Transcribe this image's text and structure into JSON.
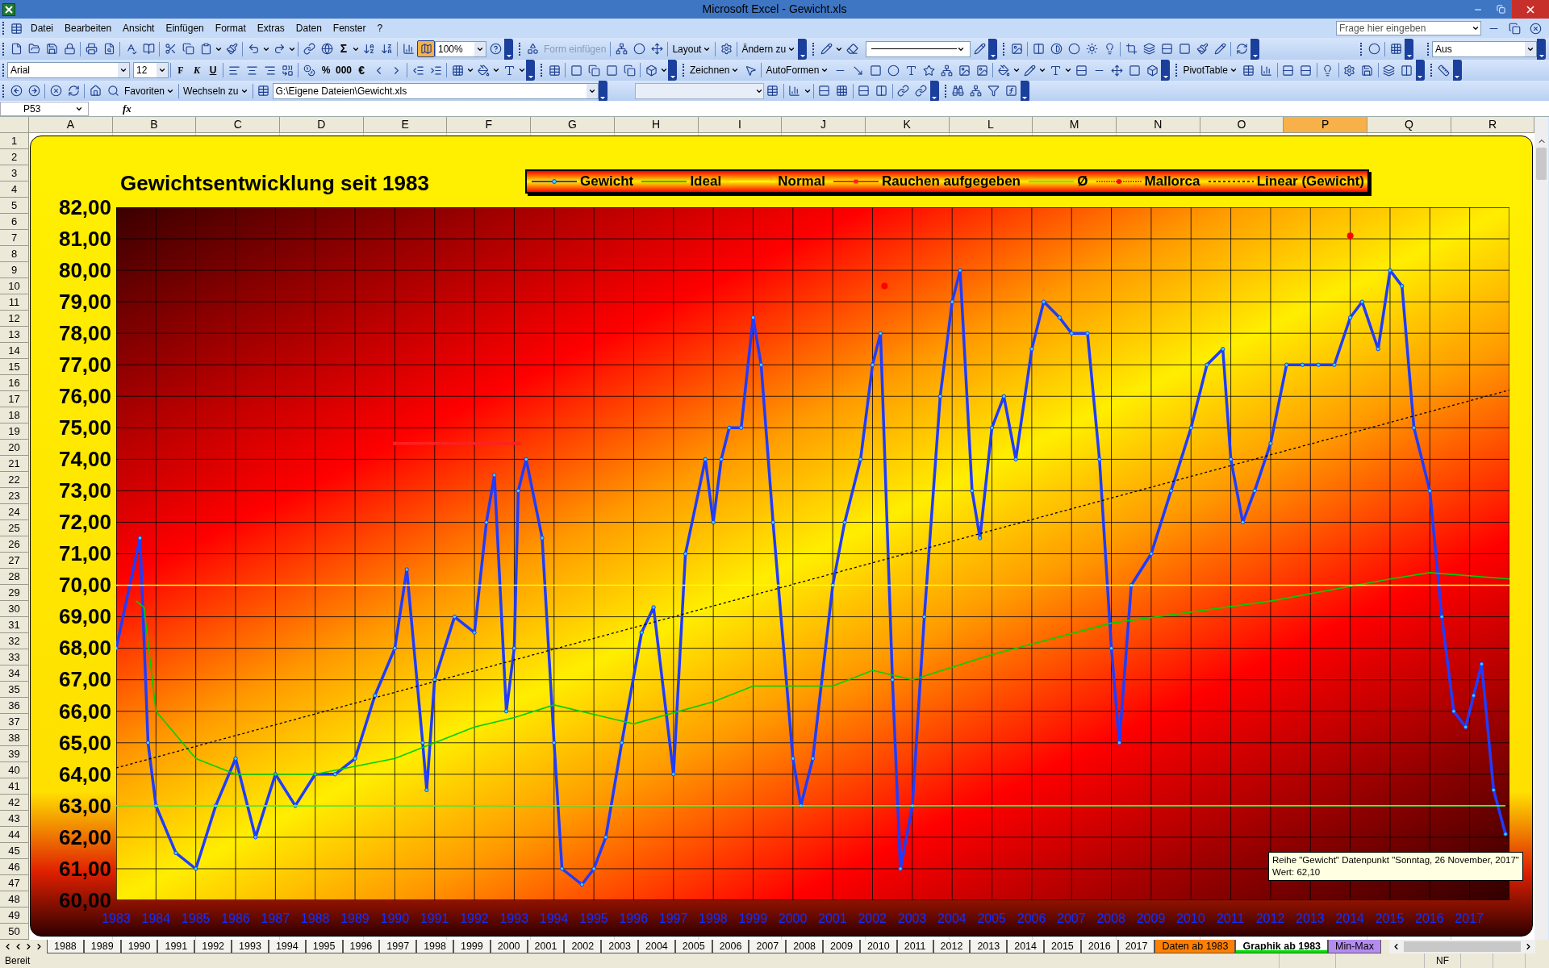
{
  "window": {
    "title": "Microsoft Excel - Gewicht.xls"
  },
  "menu": [
    "Datei",
    "Bearbeiten",
    "Ansicht",
    "Einfügen",
    "Format",
    "Extras",
    "Daten",
    "Fenster",
    "?"
  ],
  "help_search": {
    "placeholder": "Frage hier eingeben"
  },
  "toolbar_standard": {
    "autosum": "Σ",
    "zoom": "100%"
  },
  "toolbar_drawing_canvas": [
    {
      "label": "Form einfügen",
      "disabled": true,
      "menu": false
    },
    {
      "label": "Layout",
      "disabled": false,
      "menu": true
    },
    {
      "label": "Ändern zu",
      "disabled": false,
      "menu": true
    }
  ],
  "toolbar_view": {
    "value": "Aus"
  },
  "toolbar_formatting": {
    "font": "Arial",
    "size": "12",
    "bold": "F",
    "italic": "K",
    "underline": "U",
    "percent": "%",
    "thousands": "000",
    "euro": "€"
  },
  "toolbar_drawing": [
    "Zeichnen",
    "AutoFormen"
  ],
  "toolbar_pivot": "PivotTable",
  "toolbar_web": {
    "buttons": [
      "Favoriten",
      "Wechseln zu"
    ],
    "address": "G:\\Eigene Dateien\\Gewicht.xls"
  },
  "formula_bar": {
    "name_box": "P53",
    "function_button": "fx"
  },
  "columns": [
    {
      "label": "A",
      "selected": false
    },
    {
      "label": "B",
      "selected": false
    },
    {
      "label": "C",
      "selected": false
    },
    {
      "label": "D",
      "selected": false
    },
    {
      "label": "E",
      "selected": false
    },
    {
      "label": "F",
      "selected": false
    },
    {
      "label": "G",
      "selected": false
    },
    {
      "label": "H",
      "selected": false
    },
    {
      "label": "I",
      "selected": false
    },
    {
      "label": "J",
      "selected": false
    },
    {
      "label": "K",
      "selected": false
    },
    {
      "label": "L",
      "selected": false
    },
    {
      "label": "M",
      "selected": false
    },
    {
      "label": "N",
      "selected": false
    },
    {
      "label": "O",
      "selected": false
    },
    {
      "label": "P",
      "selected": true
    },
    {
      "label": "Q",
      "selected": false
    },
    {
      "label": "R",
      "selected": false
    }
  ],
  "rows": [
    "1",
    "2",
    "3",
    "4",
    "5",
    "6",
    "7",
    "8",
    "9",
    "10",
    "11",
    "12",
    "13",
    "14",
    "15",
    "16",
    "17",
    "18",
    "19",
    "20",
    "21",
    "22",
    "23",
    "24",
    "25",
    "26",
    "27",
    "28",
    "29",
    "30",
    "31",
    "32",
    "33",
    "34",
    "35",
    "36",
    "37",
    "38",
    "39",
    "40",
    "41",
    "42",
    "43",
    "44",
    "45",
    "46",
    "47",
    "48",
    "49",
    "50"
  ],
  "chart": {
    "chart_data": {
      "type": "line",
      "title": "Gewichtsentwicklung seit 1983",
      "xlim": [
        1983,
        2018
      ],
      "ylim": [
        60,
        82
      ],
      "xticks": [
        {
          "value": 1983,
          "label": "1983"
        },
        {
          "value": 1984,
          "label": "1984"
        },
        {
          "value": 1985,
          "label": "1985"
        },
        {
          "value": 1986,
          "label": "1986"
        },
        {
          "value": 1987,
          "label": "1987"
        },
        {
          "value": 1988,
          "label": "1988"
        },
        {
          "value": 1989,
          "label": "1989"
        },
        {
          "value": 1990,
          "label": "1990"
        },
        {
          "value": 1991,
          "label": "1991"
        },
        {
          "value": 1992,
          "label": "1992"
        },
        {
          "value": 1993,
          "label": "1993"
        },
        {
          "value": 1994,
          "label": "1994"
        },
        {
          "value": 1995,
          "label": "1995"
        },
        {
          "value": 1996,
          "label": "1996"
        },
        {
          "value": 1997,
          "label": "1997"
        },
        {
          "value": 1998,
          "label": "1998"
        },
        {
          "value": 1999,
          "label": "1999"
        },
        {
          "value": 2000,
          "label": "2000"
        },
        {
          "value": 2001,
          "label": "2001"
        },
        {
          "value": 2002,
          "label": "2002"
        },
        {
          "value": 2003,
          "label": "2003"
        },
        {
          "value": 2004,
          "label": "2004"
        },
        {
          "value": 2005,
          "label": "2005"
        },
        {
          "value": 2006,
          "label": "2006"
        },
        {
          "value": 2007,
          "label": "2007"
        },
        {
          "value": 2008,
          "label": "2008"
        },
        {
          "value": 2009,
          "label": "2009"
        },
        {
          "value": 2010,
          "label": "2010"
        },
        {
          "value": 2011,
          "label": "2011"
        },
        {
          "value": 2012,
          "label": "2012"
        },
        {
          "value": 2013,
          "label": "2013"
        },
        {
          "value": 2014,
          "label": "2014"
        },
        {
          "value": 2015,
          "label": "2015"
        },
        {
          "value": 2016,
          "label": "2016"
        },
        {
          "value": 2017,
          "label": "2017"
        }
      ],
      "x": [
        1983.0,
        1983.6,
        1983.8,
        1984.0,
        1984.5,
        1985.0,
        1985.5,
        1986.0,
        1986.5,
        1987.0,
        1987.5,
        1988.0,
        1988.5,
        1989.0,
        1989.5,
        1990.0,
        1990.3,
        1990.7,
        1990.8,
        1991.0,
        1991.5,
        1992.0,
        1992.3,
        1992.5,
        1992.8,
        1993.0,
        1993.1,
        1993.3,
        1993.7,
        1994.0,
        1994.2,
        1994.7,
        1995.0,
        1995.3,
        1995.7,
        1996.2,
        1996.5,
        1997.0,
        1997.3,
        1997.8,
        1998.0,
        1998.2,
        1998.4,
        1998.7,
        1999.0,
        1999.2,
        1999.5,
        2000.0,
        2000.2,
        2000.5,
        2001.0,
        2001.3,
        2001.7,
        2002.0,
        2002.2,
        2002.5,
        2002.7,
        2003.0,
        2003.3,
        2003.7,
        2004.0,
        2004.2,
        2004.5,
        2004.7,
        2005.0,
        2005.3,
        2005.6,
        2006.0,
        2006.3,
        2006.7,
        2007.0,
        2007.4,
        2007.7,
        2008.0,
        2008.2,
        2008.5,
        2009.0,
        2009.5,
        2010.0,
        2010.4,
        2010.8,
        2011.0,
        2011.3,
        2011.6,
        2012.0,
        2012.4,
        2012.8,
        2013.2,
        2013.6,
        2014.0,
        2014.3,
        2014.7,
        2015.0,
        2015.3,
        2015.6,
        2016.0,
        2016.3,
        2016.6,
        2016.9,
        2017.1,
        2017.3,
        2017.6,
        2017.9
      ],
      "yticks": [
        {
          "value": 82,
          "label": "82,00"
        },
        {
          "value": 81,
          "label": "81,00"
        },
        {
          "value": 80,
          "label": "80,00"
        },
        {
          "value": 79,
          "label": "79,00"
        },
        {
          "value": 78,
          "label": "78,00"
        },
        {
          "value": 77,
          "label": "77,00"
        },
        {
          "value": 76,
          "label": "76,00"
        },
        {
          "value": 75,
          "label": "75,00"
        },
        {
          "value": 74,
          "label": "74,00"
        },
        {
          "value": 73,
          "label": "73,00"
        },
        {
          "value": 72,
          "label": "72,00"
        },
        {
          "value": 71,
          "label": "71,00"
        },
        {
          "value": 70,
          "label": "70,00"
        },
        {
          "value": 69,
          "label": "69,00"
        },
        {
          "value": 68,
          "label": "68,00"
        },
        {
          "value": 67,
          "label": "67,00"
        },
        {
          "value": 66,
          "label": "66,00"
        },
        {
          "value": 65,
          "label": "65,00"
        },
        {
          "value": 64,
          "label": "64,00"
        },
        {
          "value": 63,
          "label": "63,00"
        },
        {
          "value": 62,
          "label": "62,00"
        },
        {
          "value": 61,
          "label": "61,00"
        },
        {
          "value": 60,
          "label": "60,00"
        }
      ],
      "series": [
        {
          "name": "Gewicht",
          "color": "#1f3cff",
          "line_style": "solid",
          "marker": "circle",
          "values": [
            68,
            71.5,
            65,
            63,
            61.5,
            61,
            63,
            64.5,
            62,
            64,
            63,
            64,
            64,
            64.5,
            66.5,
            68,
            70.5,
            65,
            63.5,
            67,
            69,
            68.5,
            72,
            73.5,
            66,
            68,
            73,
            74,
            71.5,
            65,
            61,
            60.5,
            61,
            62,
            65,
            68.5,
            69.3,
            64,
            71,
            74,
            72,
            74,
            75,
            75,
            78.5,
            77,
            72,
            64.5,
            63,
            64.5,
            70,
            72,
            74,
            77,
            78,
            67,
            61,
            63,
            69,
            76,
            79,
            80,
            73,
            71.5,
            75,
            76,
            74,
            77.5,
            79,
            78.5,
            78,
            78,
            74,
            68,
            65,
            70,
            71,
            73,
            75,
            77,
            77.5,
            74,
            72,
            73,
            74.5,
            77,
            77,
            77,
            77,
            78.5,
            79,
            77.5,
            80,
            79.5,
            75,
            73,
            69,
            66,
            65.5,
            66.5,
            67.5,
            63.5,
            62.1
          ]
        },
        {
          "name": "Ideal",
          "color": "#00d000",
          "line_style": "solid",
          "x": [
            1983.5,
            1983.7,
            1984.0,
            1985.0,
            1986.0,
            1988.0,
            1990.0,
            1992.0,
            1993.0,
            1994.0,
            1996.0,
            1998.0,
            1999.0,
            2001.0,
            2002.0,
            2003.0,
            2005.0,
            2008.0,
            2012.0,
            2015.0,
            2016.0,
            2018.0
          ],
          "values": [
            69.5,
            69.3,
            66,
            64.5,
            64,
            64,
            64.5,
            65.5,
            65.8,
            66.2,
            65.6,
            66.3,
            66.8,
            66.8,
            67.3,
            67,
            67.8,
            68.8,
            69.5,
            70.2,
            70.4,
            70.2
          ]
        },
        {
          "name": "Normal",
          "color": "#ffff00",
          "line_style": "solid",
          "x": [
            1983,
            2018
          ],
          "values": [
            70,
            70
          ]
        },
        {
          "name": "Rauchen aufgegeben",
          "color": "#ff2020",
          "line_style": "solid",
          "marker": "square",
          "x": [
            1990,
            1993.1
          ],
          "values": [
            74.5,
            74.5
          ]
        },
        {
          "name": "Ø",
          "color": "#40ff40",
          "line_style": "solid",
          "x": [
            1983,
            2017.9
          ],
          "values": [
            63,
            63
          ]
        },
        {
          "name": "Mallorca",
          "color": "#ff0000",
          "type": "scatter",
          "x": [
            2002.3,
            2014.0
          ],
          "values": [
            79.5,
            81.1
          ]
        },
        {
          "name": "Linear (Gewicht)",
          "color": "#000000",
          "line_style": "dotted",
          "x": [
            1983,
            2018
          ],
          "values": [
            64.2,
            76.2
          ]
        }
      ]
    }
  },
  "tooltip": [
    "Reihe \"Gewicht\" Datenpunkt \"Sonntag, 26 November, 2017\"",
    "Wert: 62,10"
  ],
  "sheet_tabs": [
    {
      "label": "1988",
      "selected": false
    },
    {
      "label": "1989",
      "selected": false
    },
    {
      "label": "1990",
      "selected": false
    },
    {
      "label": "1991",
      "selected": false
    },
    {
      "label": "1992",
      "selected": false
    },
    {
      "label": "1993",
      "selected": false
    },
    {
      "label": "1994",
      "selected": false
    },
    {
      "label": "1995",
      "selected": false
    },
    {
      "label": "1996",
      "selected": false
    },
    {
      "label": "1997",
      "selected": false
    },
    {
      "label": "1998",
      "selected": false
    },
    {
      "label": "1999",
      "selected": false
    },
    {
      "label": "2000",
      "selected": false
    },
    {
      "label": "2001",
      "selected": false
    },
    {
      "label": "2002",
      "selected": false
    },
    {
      "label": "2003",
      "selected": false
    },
    {
      "label": "2004",
      "selected": false
    },
    {
      "label": "2005",
      "selected": false
    },
    {
      "label": "2006",
      "selected": false
    },
    {
      "label": "2007",
      "selected": false
    },
    {
      "label": "2008",
      "selected": false
    },
    {
      "label": "2009",
      "selected": false
    },
    {
      "label": "2010",
      "selected": false
    },
    {
      "label": "2011",
      "selected": false
    },
    {
      "label": "2012",
      "selected": false
    },
    {
      "label": "2013",
      "selected": false
    },
    {
      "label": "2014",
      "selected": false
    },
    {
      "label": "2015",
      "selected": false
    },
    {
      "label": "2016",
      "selected": false
    },
    {
      "label": "2017",
      "selected": false
    },
    {
      "label": "Daten ab 1983",
      "selected": false,
      "color": "#ff8000"
    },
    {
      "label": "Graphik ab 1983",
      "selected": true,
      "color": "#00e000"
    },
    {
      "label": "Min-Max",
      "selected": false,
      "color": "#b48cf0"
    }
  ],
  "status_bar": {
    "text": "Bereit",
    "indicators": [
      "NF"
    ]
  }
}
